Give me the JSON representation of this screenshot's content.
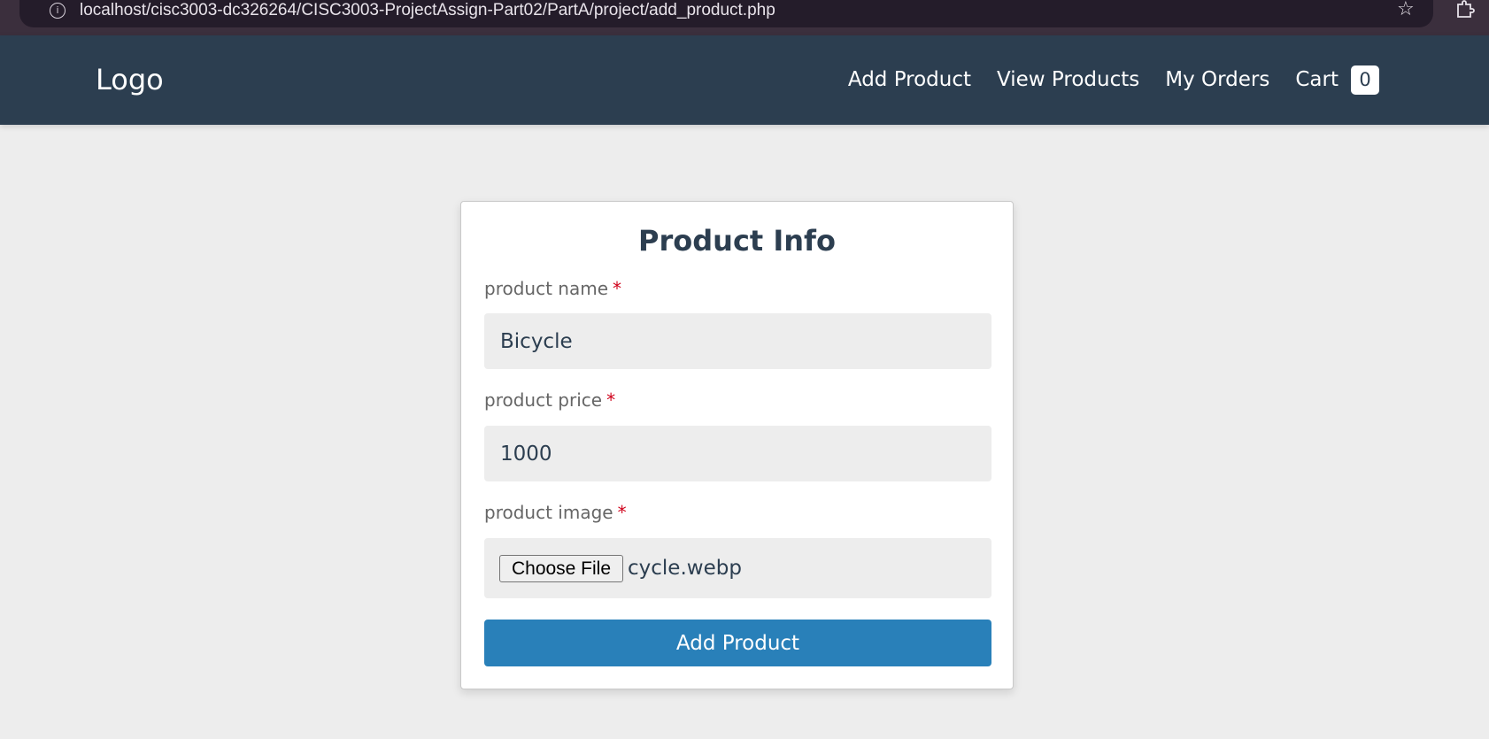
{
  "browser": {
    "url": "localhost/cisc3003-dc326264/CISC3003-ProjectAssign-Part02/PartA/project/add_product.php",
    "info_icon": "info-icon",
    "bookmark_icon": "star-icon",
    "extensions_icon": "puzzle-icon"
  },
  "nav": {
    "logo": "Logo",
    "links": [
      "Add Product",
      "View Products",
      "My Orders",
      "Cart"
    ],
    "cart_count": "0"
  },
  "form": {
    "title": "Product Info",
    "required_marker": "*",
    "name_label": "product name",
    "name_value": "Bicycle",
    "price_label": "product price",
    "price_value": "1000",
    "image_label": "product image",
    "file_button": "Choose File",
    "file_name": "cycle.webp",
    "submit_label": "Add Product"
  },
  "colors": {
    "navbar": "#2c3e50",
    "accent": "#2980b9",
    "required": "#d0021b",
    "background": "#ededed"
  }
}
